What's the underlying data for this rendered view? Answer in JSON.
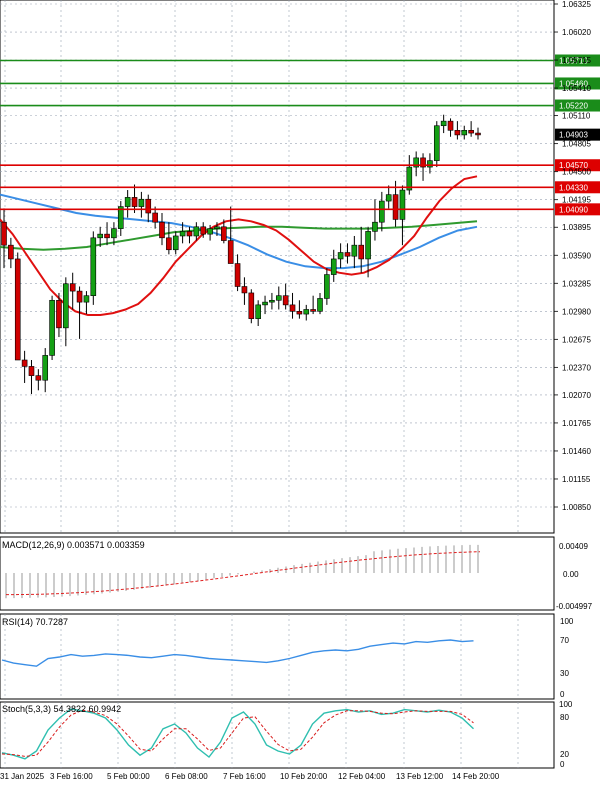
{
  "chart_data": [
    {
      "type": "candlestick",
      "symbol_hint": "EURUSD-like price chart",
      "price_axis_ticks": [
        "1.06325",
        "1.06020",
        "1.05715",
        "1.05410",
        "1.05110",
        "1.04805",
        "1.04500",
        "1.04195",
        "1.03895",
        "1.03590",
        "1.03285",
        "1.02980",
        "1.02675",
        "1.02370",
        "1.02070",
        "1.01765",
        "1.01460",
        "1.01155",
        "1.00850"
      ],
      "price_range": [
        1.0085,
        1.06325
      ],
      "current_price": "1.04903",
      "horizontal_levels": [
        {
          "label": "1.05710",
          "value": 1.0571,
          "color": "#1a8c1a"
        },
        {
          "label": "1.05460",
          "value": 1.0546,
          "color": "#1a8c1a"
        },
        {
          "label": "1.05220",
          "value": 1.0522,
          "color": "#1a8c1a"
        },
        {
          "label": "1.04570",
          "value": 1.0457,
          "color": "#dd0000"
        },
        {
          "label": "1.04330",
          "value": 1.0433,
          "color": "#dd0000"
        },
        {
          "label": "1.04090",
          "value": 1.0409,
          "color": "#dd0000"
        }
      ],
      "x_tick_labels": [
        "31 Jan 2025",
        "3 Feb 16:00",
        "5 Feb 00:00",
        "6 Feb 08:00",
        "7 Feb 16:00",
        "10 Feb 20:00",
        "12 Feb 04:00",
        "13 Feb 12:00",
        "14 Feb 20:00"
      ],
      "candles": [
        [
          1.0395,
          1.041,
          1.0345,
          1.037
        ],
        [
          1.037,
          1.0378,
          1.0345,
          1.0355
        ],
        [
          1.0355,
          1.0362,
          1.0262,
          1.0245
        ],
        [
          1.0245,
          1.0255,
          1.022,
          1.0238
        ],
        [
          1.0238,
          1.0245,
          1.0208,
          1.0228
        ],
        [
          1.0228,
          1.0235,
          1.0212,
          1.0223
        ],
        [
          1.0223,
          1.0258,
          1.021,
          1.025
        ],
        [
          1.025,
          1.0315,
          1.0245,
          1.031
        ],
        [
          1.031,
          1.0318,
          1.027,
          1.028
        ],
        [
          1.028,
          1.0335,
          1.026,
          1.0328
        ],
        [
          1.0328,
          1.034,
          1.03,
          1.032
        ],
        [
          1.032,
          1.0325,
          1.0268,
          1.0308
        ],
        [
          1.0308,
          1.032,
          1.0295,
          1.0315
        ],
        [
          1.0315,
          1.0385,
          1.0305,
          1.0378
        ],
        [
          1.0378,
          1.039,
          1.0368,
          1.0382
        ],
        [
          1.0382,
          1.0395,
          1.037,
          1.0378
        ],
        [
          1.0378,
          1.0395,
          1.037,
          1.0388
        ],
        [
          1.0388,
          1.0418,
          1.038,
          1.0412
        ],
        [
          1.0412,
          1.043,
          1.04,
          1.0422
        ],
        [
          1.0422,
          1.0436,
          1.0405,
          1.0412
        ],
        [
          1.0412,
          1.0428,
          1.04,
          1.042
        ],
        [
          1.042,
          1.0425,
          1.0395,
          1.0405
        ],
        [
          1.0405,
          1.0412,
          1.0388,
          1.0395
        ],
        [
          1.0395,
          1.0405,
          1.037,
          1.0378
        ],
        [
          1.0378,
          1.0395,
          1.036,
          1.0365
        ],
        [
          1.0365,
          1.0385,
          1.036,
          1.038
        ],
        [
          1.038,
          1.0395,
          1.0372,
          1.0385
        ],
        [
          1.0385,
          1.039,
          1.0372,
          1.038
        ],
        [
          1.038,
          1.0395,
          1.0375,
          1.039
        ],
        [
          1.039,
          1.0395,
          1.0378,
          1.0382
        ],
        [
          1.0382,
          1.0392,
          1.0375,
          1.0388
        ],
        [
          1.0388,
          1.0395,
          1.038,
          1.039
        ],
        [
          1.039,
          1.0398,
          1.0372,
          1.0375
        ],
        [
          1.0375,
          1.0412,
          1.0355,
          1.035
        ],
        [
          1.035,
          1.036,
          1.032,
          1.0325
        ],
        [
          1.0325,
          1.0335,
          1.0305,
          1.0318
        ],
        [
          1.0318,
          1.0322,
          1.0285,
          1.029
        ],
        [
          1.029,
          1.031,
          1.0282,
          1.0305
        ],
        [
          1.0305,
          1.0315,
          1.0295,
          1.0308
        ],
        [
          1.0308,
          1.0318,
          1.03,
          1.031
        ],
        [
          1.031,
          1.0325,
          1.03,
          1.0315
        ],
        [
          1.0315,
          1.0328,
          1.03,
          1.0305
        ],
        [
          1.0305,
          1.0318,
          1.029,
          1.0298
        ],
        [
          1.0298,
          1.031,
          1.029,
          1.0295
        ],
        [
          1.0295,
          1.0305,
          1.0288,
          1.03
        ],
        [
          1.03,
          1.0315,
          1.0295,
          1.0298
        ],
        [
          1.0298,
          1.0318,
          1.0295,
          1.0312
        ],
        [
          1.0312,
          1.0345,
          1.0305,
          1.0338
        ],
        [
          1.0338,
          1.0365,
          1.033,
          1.0355
        ],
        [
          1.0355,
          1.0372,
          1.0345,
          1.0362
        ],
        [
          1.0362,
          1.0372,
          1.035,
          1.0358
        ],
        [
          1.0358,
          1.038,
          1.0345,
          1.037
        ],
        [
          1.037,
          1.039,
          1.034,
          1.0355
        ],
        [
          1.0355,
          1.039,
          1.0335,
          1.0385
        ],
        [
          1.0385,
          1.042,
          1.0375,
          1.0395
        ],
        [
          1.0395,
          1.0428,
          1.0385,
          1.0418
        ],
        [
          1.0418,
          1.0435,
          1.041,
          1.0425
        ],
        [
          1.0425,
          1.044,
          1.039,
          1.0398
        ],
        [
          1.0398,
          1.0435,
          1.037,
          1.043
        ],
        [
          1.043,
          1.0468,
          1.0425,
          1.0455
        ],
        [
          1.0455,
          1.0472,
          1.0445,
          1.0465
        ],
        [
          1.0465,
          1.047,
          1.044,
          1.0455
        ],
        [
          1.0455,
          1.047,
          1.0448,
          1.0462
        ],
        [
          1.0462,
          1.0505,
          1.0455,
          1.05
        ],
        [
          1.05,
          1.0512,
          1.0492,
          1.0505
        ],
        [
          1.0505,
          1.0508,
          1.0488,
          1.0495
        ],
        [
          1.0495,
          1.0505,
          1.0485,
          1.049
        ],
        [
          1.049,
          1.05,
          1.0485,
          1.0495
        ],
        [
          1.0495,
          1.0505,
          1.0488,
          1.0492
        ],
        [
          1.0492,
          1.0498,
          1.0485,
          1.049
        ]
      ],
      "sma_red": [
        1.0398,
        1.0382,
        1.0362,
        1.0342,
        1.0322,
        1.0308,
        1.0298,
        1.0294,
        1.0294,
        1.0296,
        1.03,
        1.0306,
        1.0318,
        1.0334,
        1.0352,
        1.0366,
        1.038,
        1.039,
        1.0396,
        1.0398,
        1.0396,
        1.0392,
        1.0386,
        1.0376,
        1.0364,
        1.0352,
        1.0344,
        1.034,
        1.0338,
        1.034,
        1.0346,
        1.0354,
        1.0366,
        1.038,
        1.04,
        1.0418,
        1.0432,
        1.0442,
        1.0445
      ],
      "sma_green": [
        1.0368,
        1.0366,
        1.0365,
        1.0366,
        1.0368,
        1.0372,
        1.0376,
        1.038,
        1.0384,
        1.0386,
        1.0388,
        1.0389,
        1.039,
        1.039,
        1.0389,
        1.0388,
        1.0388,
        1.0388,
        1.0389,
        1.039,
        1.0392,
        1.0394,
        1.0396
      ],
      "sma_blue": [
        1.0425,
        1.042,
        1.0415,
        1.041,
        1.0405,
        1.0402,
        1.04,
        1.0398,
        1.0396,
        1.0394,
        1.039,
        1.0385,
        1.0378,
        1.037,
        1.036,
        1.0352,
        1.0347,
        1.0345,
        1.0345,
        1.0347,
        1.0352,
        1.036,
        1.0368,
        1.0378,
        1.0386,
        1.039
      ]
    },
    {
      "type": "histogram+line",
      "name": "MACD(12,26,9) 0.003571 0.003359",
      "y_ticks": [
        "0.00409",
        "0.00",
        "-0.004997"
      ],
      "y_range": [
        -0.0055,
        0.0045
      ]
    },
    {
      "type": "line",
      "name": "RSI(14) 70.7287",
      "y_ticks": [
        "100",
        "70",
        "30",
        "0"
      ],
      "y_range": [
        0,
        100
      ]
    },
    {
      "type": "line",
      "name": "Stoch(5,3,3) 54.3822 60.9942",
      "y_ticks": [
        "100",
        "80",
        "20",
        "0"
      ],
      "y_range": [
        0,
        100
      ]
    }
  ]
}
